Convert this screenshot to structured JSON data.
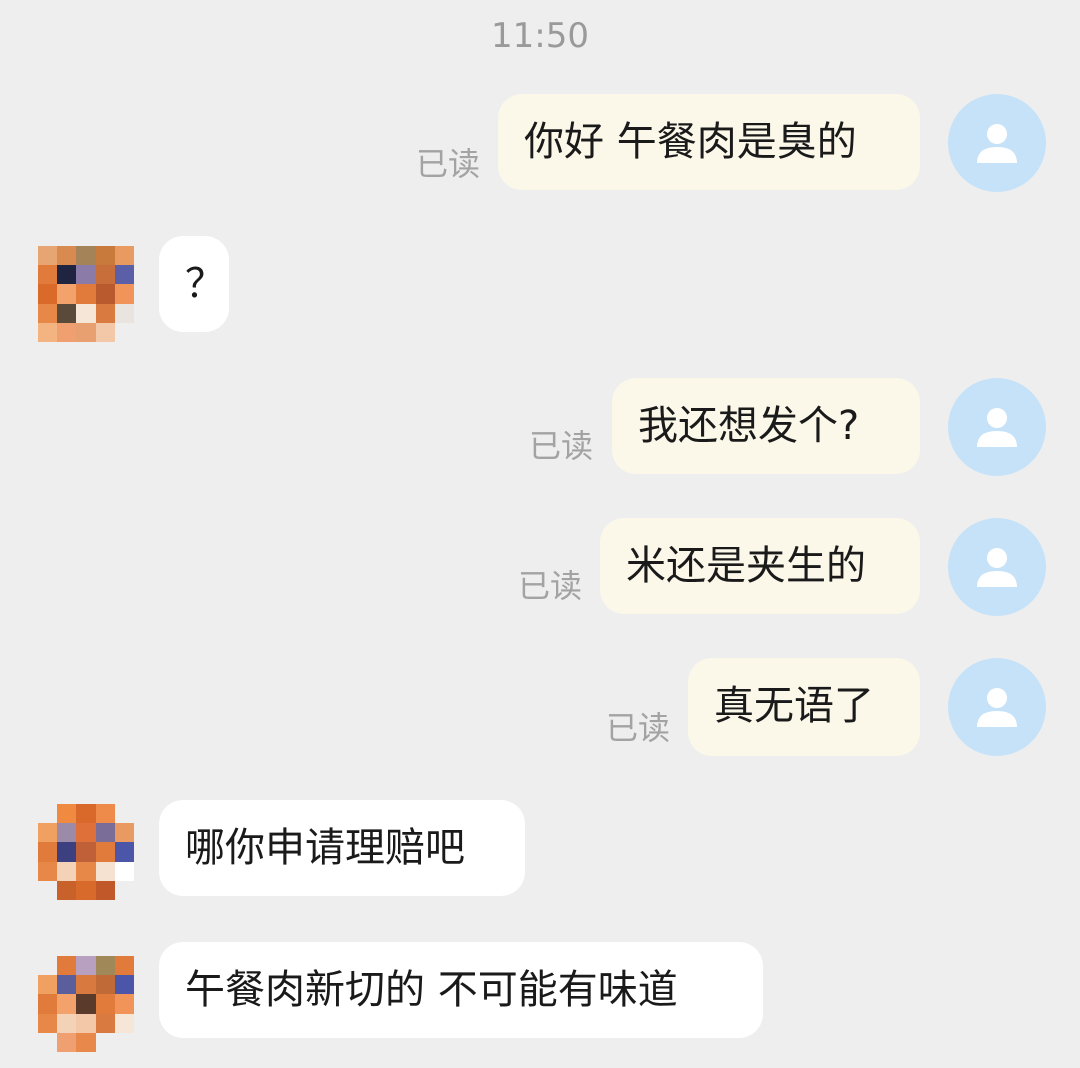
{
  "time": "11:50",
  "read_label": "已读",
  "messages": [
    {
      "side": "me",
      "text": "你好 午餐肉是臭的"
    },
    {
      "side": "them",
      "text": "？"
    },
    {
      "side": "me",
      "text": "我还想发个?"
    },
    {
      "side": "me",
      "text": "米还是夹生的"
    },
    {
      "side": "me",
      "text": "真无语了"
    },
    {
      "side": "them",
      "text": "哪你申请理赔吧"
    },
    {
      "side": "them",
      "text": "午餐肉新切的 不可能有味道"
    }
  ],
  "colors": {
    "background": "#eeeeee",
    "my_bubble": "#fbf8ea",
    "their_bubble": "#ffffff",
    "my_avatar_bg": "#c6e2f8",
    "read_text": "#a3a3a3"
  },
  "icons": {
    "my_avatar": "person-icon",
    "their_avatar": "pixelated-avatar"
  }
}
